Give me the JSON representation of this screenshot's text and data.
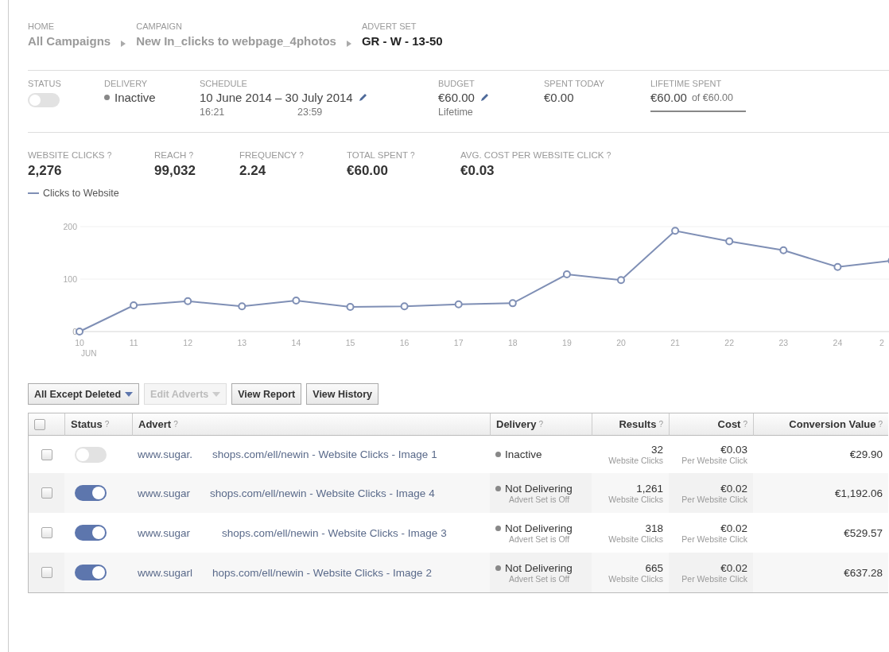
{
  "breadcrumb": [
    {
      "caption": "HOME",
      "label": "All Campaigns",
      "current": false
    },
    {
      "caption": "CAMPAIGN",
      "label": "New In_clicks to webpage_4photos",
      "current": false
    },
    {
      "caption": "ADVERT SET",
      "label": "GR - W - 13-50",
      "current": true
    }
  ],
  "summary": {
    "status": {
      "caption": "STATUS",
      "on": false
    },
    "delivery": {
      "caption": "DELIVERY",
      "value": "Inactive"
    },
    "schedule": {
      "caption": "SCHEDULE",
      "start": "10 June 2014",
      "dash": "–",
      "end": "30 July 2014",
      "start_time": "16:21",
      "end_time": "23:59"
    },
    "budget": {
      "caption": "BUDGET",
      "value": "€60.00",
      "sub": "Lifetime"
    },
    "spent_today": {
      "caption": "SPENT TODAY",
      "value": "€0.00"
    },
    "lifetime_spent": {
      "caption": "LIFETIME SPENT",
      "value": "€60.00",
      "of": "of €60.00",
      "level": 1
    }
  },
  "metrics": [
    {
      "label": "WEBSITE CLICKS",
      "help": "?",
      "value": "2,276"
    },
    {
      "label": "REACH",
      "help": "?",
      "value": "99,032"
    },
    {
      "label": "FREQUENCY",
      "help": "?",
      "value": "2.24"
    },
    {
      "label": "TOTAL SPENT",
      "help": "?",
      "value": "€60.00"
    },
    {
      "label": "AVG. COST PER WEBSITE CLICK",
      "help": "?",
      "value": "€0.03"
    }
  ],
  "chart": {
    "month": "JUN",
    "chart_data": {
      "type": "line",
      "categories": [
        "10",
        "11",
        "12",
        "13",
        "14",
        "15",
        "16",
        "17",
        "18",
        "19",
        "20",
        "21",
        "22",
        "23",
        "24",
        "2"
      ],
      "series": [
        {
          "name": "Clicks to Website",
          "color": "#7f8fb5",
          "marker": "circle",
          "values": [
            0,
            50,
            58,
            48,
            59,
            47,
            48,
            52,
            54,
            109,
            98,
            192,
            172,
            155,
            123,
            135
          ]
        }
      ],
      "yticks": [
        0,
        100,
        200
      ],
      "ylim": [
        0,
        200
      ]
    }
  },
  "toolbar": [
    {
      "label": "All Except Deleted",
      "dropdown": true,
      "disabled": false
    },
    {
      "label": "Edit Adverts",
      "dropdown": true,
      "disabled": true
    },
    {
      "label": "View Report",
      "dropdown": false,
      "disabled": false
    },
    {
      "label": "View History",
      "dropdown": false,
      "disabled": false
    }
  ],
  "table": {
    "header_checked": false,
    "columns": [
      {
        "label": "Status",
        "help": "?"
      },
      {
        "label": "Advert",
        "help": "?"
      },
      {
        "label": "Delivery",
        "help": "?"
      },
      {
        "label": "Results",
        "help": "?"
      },
      {
        "label": "Cost",
        "help": "?"
      },
      {
        "label": "Conversion Value",
        "help": "?"
      }
    ],
    "rows": [
      {
        "checked": false,
        "on": false,
        "advert_start": "www.sugar.",
        "advert_end": "shops.com/ell/newin - Website Clicks - Image 1",
        "delivery": "Inactive",
        "results": "32",
        "results_sub": "Website Clicks",
        "cost": "€0.03",
        "cost_sub": "Per Website Click",
        "conversion_value": "€29.90"
      },
      {
        "checked": false,
        "on": true,
        "advert_start": "www.sugar",
        "advert_end": "shops.com/ell/newin - Website Clicks - Image 4",
        "delivery": "Not Delivering",
        "delivery_sub": "Advert Set is Off",
        "results": "1,261",
        "results_sub": "Website Clicks",
        "cost": "€0.02",
        "cost_sub": "Per Website Click",
        "conversion_value": "€1,192.06"
      },
      {
        "checked": false,
        "on": true,
        "advert_start": "www.sugar",
        "advert_end": "shops.com/ell/newin - Website Clicks - Image 3",
        "delivery": "Not Delivering",
        "delivery_sub": "Advert Set is Off",
        "results": "318",
        "results_sub": "Website Clicks",
        "cost": "€0.02",
        "cost_sub": "Per Website Click",
        "conversion_value": "€529.57"
      },
      {
        "checked": false,
        "on": true,
        "advert_start": "www.sugarl",
        "advert_end": "hops.com/ell/newin - Website Clicks - Image 2",
        "delivery": "Not Delivering",
        "delivery_sub": "Advert Set is Off",
        "results": "665",
        "results_sub": "Website Clicks",
        "cost": "€0.02",
        "cost_sub": "Per Website Click",
        "conversion_value": "€637.28"
      }
    ]
  }
}
